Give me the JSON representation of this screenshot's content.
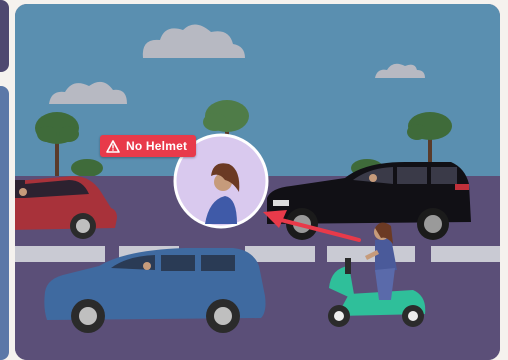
{
  "alert": {
    "label": "No Helmet",
    "icon": "warning-triangle-icon",
    "color": "#e83a4a"
  },
  "scene": {
    "sky_color": "#5a8fb0",
    "road_color": "#5b4f78",
    "highlight_circle_color": "#d9c9ee",
    "arrow_color": "#e83a4a"
  }
}
